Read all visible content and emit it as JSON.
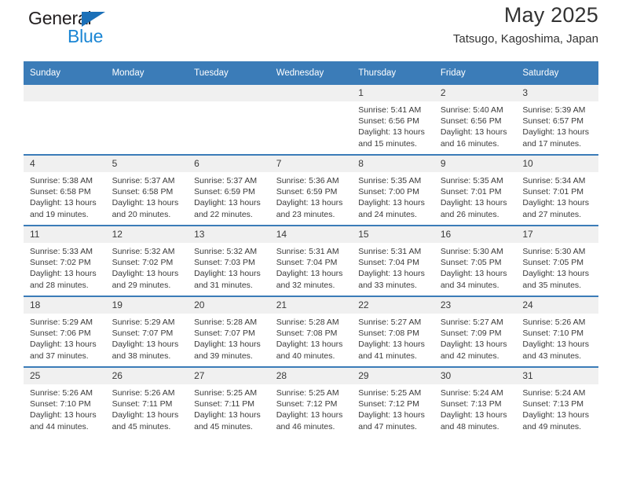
{
  "brand": {
    "name_top": "General",
    "name_bottom": "Blue",
    "triangle_color": "#1b70b8",
    "top_color": "#231f20",
    "bottom_color": "#1b86d4"
  },
  "header": {
    "title": "May 2025",
    "subtitle": "Tatsugo, Kagoshima, Japan"
  },
  "theme": {
    "header_bg": "#3b7cb8",
    "daynum_bg": "#f0f0f0",
    "row_divider": "#3b7cb8",
    "text": "#3a3a3a"
  },
  "weekdays": [
    "Sunday",
    "Monday",
    "Tuesday",
    "Wednesday",
    "Thursday",
    "Friday",
    "Saturday"
  ],
  "weeks": [
    [
      {
        "day": "",
        "empty": true,
        "sunrise": "",
        "sunset": "",
        "daylight": ""
      },
      {
        "day": "",
        "empty": true,
        "sunrise": "",
        "sunset": "",
        "daylight": ""
      },
      {
        "day": "",
        "empty": true,
        "sunrise": "",
        "sunset": "",
        "daylight": ""
      },
      {
        "day": "",
        "empty": true,
        "sunrise": "",
        "sunset": "",
        "daylight": ""
      },
      {
        "day": "1",
        "empty": false,
        "sunrise": "Sunrise: 5:41 AM",
        "sunset": "Sunset: 6:56 PM",
        "daylight": "Daylight: 13 hours and 15 minutes."
      },
      {
        "day": "2",
        "empty": false,
        "sunrise": "Sunrise: 5:40 AM",
        "sunset": "Sunset: 6:56 PM",
        "daylight": "Daylight: 13 hours and 16 minutes."
      },
      {
        "day": "3",
        "empty": false,
        "sunrise": "Sunrise: 5:39 AM",
        "sunset": "Sunset: 6:57 PM",
        "daylight": "Daylight: 13 hours and 17 minutes."
      }
    ],
    [
      {
        "day": "4",
        "empty": false,
        "sunrise": "Sunrise: 5:38 AM",
        "sunset": "Sunset: 6:58 PM",
        "daylight": "Daylight: 13 hours and 19 minutes."
      },
      {
        "day": "5",
        "empty": false,
        "sunrise": "Sunrise: 5:37 AM",
        "sunset": "Sunset: 6:58 PM",
        "daylight": "Daylight: 13 hours and 20 minutes."
      },
      {
        "day": "6",
        "empty": false,
        "sunrise": "Sunrise: 5:37 AM",
        "sunset": "Sunset: 6:59 PM",
        "daylight": "Daylight: 13 hours and 22 minutes."
      },
      {
        "day": "7",
        "empty": false,
        "sunrise": "Sunrise: 5:36 AM",
        "sunset": "Sunset: 6:59 PM",
        "daylight": "Daylight: 13 hours and 23 minutes."
      },
      {
        "day": "8",
        "empty": false,
        "sunrise": "Sunrise: 5:35 AM",
        "sunset": "Sunset: 7:00 PM",
        "daylight": "Daylight: 13 hours and 24 minutes."
      },
      {
        "day": "9",
        "empty": false,
        "sunrise": "Sunrise: 5:35 AM",
        "sunset": "Sunset: 7:01 PM",
        "daylight": "Daylight: 13 hours and 26 minutes."
      },
      {
        "day": "10",
        "empty": false,
        "sunrise": "Sunrise: 5:34 AM",
        "sunset": "Sunset: 7:01 PM",
        "daylight": "Daylight: 13 hours and 27 minutes."
      }
    ],
    [
      {
        "day": "11",
        "empty": false,
        "sunrise": "Sunrise: 5:33 AM",
        "sunset": "Sunset: 7:02 PM",
        "daylight": "Daylight: 13 hours and 28 minutes."
      },
      {
        "day": "12",
        "empty": false,
        "sunrise": "Sunrise: 5:32 AM",
        "sunset": "Sunset: 7:02 PM",
        "daylight": "Daylight: 13 hours and 29 minutes."
      },
      {
        "day": "13",
        "empty": false,
        "sunrise": "Sunrise: 5:32 AM",
        "sunset": "Sunset: 7:03 PM",
        "daylight": "Daylight: 13 hours and 31 minutes."
      },
      {
        "day": "14",
        "empty": false,
        "sunrise": "Sunrise: 5:31 AM",
        "sunset": "Sunset: 7:04 PM",
        "daylight": "Daylight: 13 hours and 32 minutes."
      },
      {
        "day": "15",
        "empty": false,
        "sunrise": "Sunrise: 5:31 AM",
        "sunset": "Sunset: 7:04 PM",
        "daylight": "Daylight: 13 hours and 33 minutes."
      },
      {
        "day": "16",
        "empty": false,
        "sunrise": "Sunrise: 5:30 AM",
        "sunset": "Sunset: 7:05 PM",
        "daylight": "Daylight: 13 hours and 34 minutes."
      },
      {
        "day": "17",
        "empty": false,
        "sunrise": "Sunrise: 5:30 AM",
        "sunset": "Sunset: 7:05 PM",
        "daylight": "Daylight: 13 hours and 35 minutes."
      }
    ],
    [
      {
        "day": "18",
        "empty": false,
        "sunrise": "Sunrise: 5:29 AM",
        "sunset": "Sunset: 7:06 PM",
        "daylight": "Daylight: 13 hours and 37 minutes."
      },
      {
        "day": "19",
        "empty": false,
        "sunrise": "Sunrise: 5:29 AM",
        "sunset": "Sunset: 7:07 PM",
        "daylight": "Daylight: 13 hours and 38 minutes."
      },
      {
        "day": "20",
        "empty": false,
        "sunrise": "Sunrise: 5:28 AM",
        "sunset": "Sunset: 7:07 PM",
        "daylight": "Daylight: 13 hours and 39 minutes."
      },
      {
        "day": "21",
        "empty": false,
        "sunrise": "Sunrise: 5:28 AM",
        "sunset": "Sunset: 7:08 PM",
        "daylight": "Daylight: 13 hours and 40 minutes."
      },
      {
        "day": "22",
        "empty": false,
        "sunrise": "Sunrise: 5:27 AM",
        "sunset": "Sunset: 7:08 PM",
        "daylight": "Daylight: 13 hours and 41 minutes."
      },
      {
        "day": "23",
        "empty": false,
        "sunrise": "Sunrise: 5:27 AM",
        "sunset": "Sunset: 7:09 PM",
        "daylight": "Daylight: 13 hours and 42 minutes."
      },
      {
        "day": "24",
        "empty": false,
        "sunrise": "Sunrise: 5:26 AM",
        "sunset": "Sunset: 7:10 PM",
        "daylight": "Daylight: 13 hours and 43 minutes."
      }
    ],
    [
      {
        "day": "25",
        "empty": false,
        "sunrise": "Sunrise: 5:26 AM",
        "sunset": "Sunset: 7:10 PM",
        "daylight": "Daylight: 13 hours and 44 minutes."
      },
      {
        "day": "26",
        "empty": false,
        "sunrise": "Sunrise: 5:26 AM",
        "sunset": "Sunset: 7:11 PM",
        "daylight": "Daylight: 13 hours and 45 minutes."
      },
      {
        "day": "27",
        "empty": false,
        "sunrise": "Sunrise: 5:25 AM",
        "sunset": "Sunset: 7:11 PM",
        "daylight": "Daylight: 13 hours and 45 minutes."
      },
      {
        "day": "28",
        "empty": false,
        "sunrise": "Sunrise: 5:25 AM",
        "sunset": "Sunset: 7:12 PM",
        "daylight": "Daylight: 13 hours and 46 minutes."
      },
      {
        "day": "29",
        "empty": false,
        "sunrise": "Sunrise: 5:25 AM",
        "sunset": "Sunset: 7:12 PM",
        "daylight": "Daylight: 13 hours and 47 minutes."
      },
      {
        "day": "30",
        "empty": false,
        "sunrise": "Sunrise: 5:24 AM",
        "sunset": "Sunset: 7:13 PM",
        "daylight": "Daylight: 13 hours and 48 minutes."
      },
      {
        "day": "31",
        "empty": false,
        "sunrise": "Sunrise: 5:24 AM",
        "sunset": "Sunset: 7:13 PM",
        "daylight": "Daylight: 13 hours and 49 minutes."
      }
    ]
  ]
}
